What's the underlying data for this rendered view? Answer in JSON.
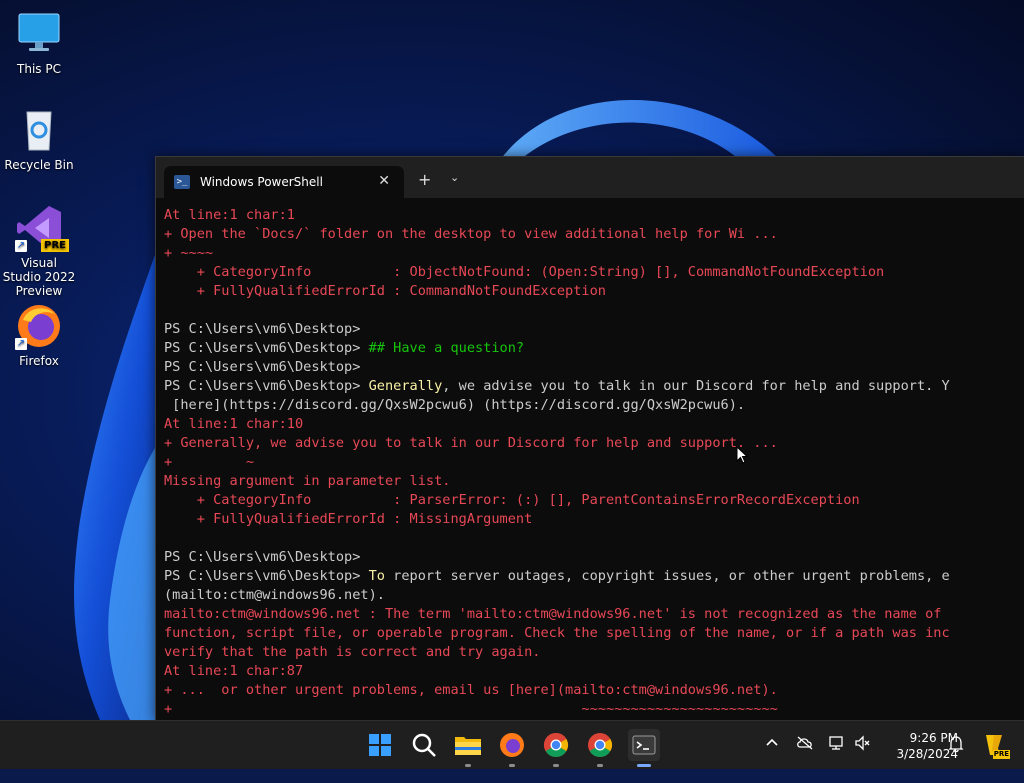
{
  "desktop": {
    "icons": [
      {
        "label": "This PC"
      },
      {
        "label": "Recycle Bin"
      },
      {
        "label": "Visual Studio 2022 Preview",
        "badge": "PRE"
      },
      {
        "label": "Firefox"
      }
    ]
  },
  "terminal": {
    "tab_title": "Windows PowerShell",
    "tab_icon_glyph": ">_",
    "close_glyph": "✕",
    "new_tab_glyph": "+",
    "dropdown_glyph": "⌄",
    "lines": [
      {
        "segments": [
          {
            "t": "err",
            "v": "At line:1 char:1"
          }
        ]
      },
      {
        "segments": [
          {
            "t": "err",
            "v": "+ Open the `Docs/` folder on the desktop to view additional help for Wi ..."
          }
        ]
      },
      {
        "segments": [
          {
            "t": "err",
            "v": "+ ~~~~"
          }
        ]
      },
      {
        "segments": [
          {
            "t": "err",
            "v": "    + CategoryInfo          : ObjectNotFound: (Open:String) [], CommandNotFoundException"
          }
        ]
      },
      {
        "segments": [
          {
            "t": "err",
            "v": "    + FullyQualifiedErrorId : CommandNotFoundException"
          }
        ]
      },
      {
        "segments": [
          {
            "t": "norm",
            "v": ""
          }
        ]
      },
      {
        "segments": [
          {
            "t": "norm",
            "v": "PS C:\\Users\\vm6\\Desktop>"
          }
        ]
      },
      {
        "segments": [
          {
            "t": "norm",
            "v": "PS C:\\Users\\vm6\\Desktop> "
          },
          {
            "t": "cmt",
            "v": "## Have a question?"
          }
        ]
      },
      {
        "segments": [
          {
            "t": "norm",
            "v": "PS C:\\Users\\vm6\\Desktop>"
          }
        ]
      },
      {
        "segments": [
          {
            "t": "norm",
            "v": "PS C:\\Users\\vm6\\Desktop> "
          },
          {
            "t": "cmd",
            "v": "Generally"
          },
          {
            "t": "norm",
            "v": ", we advise you to talk in our Discord for help and support. Y"
          }
        ]
      },
      {
        "segments": [
          {
            "t": "norm",
            "v": " [here](https://discord.gg/QxsW2pcwu6) (https://discord.gg/QxsW2pcwu6)."
          }
        ]
      },
      {
        "segments": [
          {
            "t": "err",
            "v": "At line:1 char:10"
          }
        ]
      },
      {
        "segments": [
          {
            "t": "err",
            "v": "+ Generally, we advise you to talk in our Discord for help and support. ..."
          }
        ]
      },
      {
        "segments": [
          {
            "t": "err",
            "v": "+         ~"
          }
        ]
      },
      {
        "segments": [
          {
            "t": "err",
            "v": "Missing argument in parameter list."
          }
        ]
      },
      {
        "segments": [
          {
            "t": "err",
            "v": "    + CategoryInfo          : ParserError: (:) [], ParentContainsErrorRecordException"
          }
        ]
      },
      {
        "segments": [
          {
            "t": "err",
            "v": "    + FullyQualifiedErrorId : MissingArgument"
          }
        ]
      },
      {
        "segments": [
          {
            "t": "norm",
            "v": ""
          }
        ]
      },
      {
        "segments": [
          {
            "t": "norm",
            "v": "PS C:\\Users\\vm6\\Desktop>"
          }
        ]
      },
      {
        "segments": [
          {
            "t": "norm",
            "v": "PS C:\\Users\\vm6\\Desktop> "
          },
          {
            "t": "cmd",
            "v": "To"
          },
          {
            "t": "norm",
            "v": " report server outages, copyright issues, or other urgent problems, e"
          }
        ]
      },
      {
        "segments": [
          {
            "t": "norm",
            "v": "(mailto:ctm@windows96.net)."
          }
        ]
      },
      {
        "segments": [
          {
            "t": "err",
            "v": "mailto:ctm@windows96.net : The term 'mailto:ctm@windows96.net' is not recognized as the name of"
          }
        ]
      },
      {
        "segments": [
          {
            "t": "err",
            "v": "function, script file, or operable program. Check the spelling of the name, or if a path was inc"
          }
        ]
      },
      {
        "segments": [
          {
            "t": "err",
            "v": "verify that the path is correct and try again."
          }
        ]
      },
      {
        "segments": [
          {
            "t": "err",
            "v": "At line:1 char:87"
          }
        ]
      },
      {
        "segments": [
          {
            "t": "err",
            "v": "+ ...  or other urgent problems, email us [here](mailto:ctm@windows96.net)."
          }
        ]
      },
      {
        "segments": [
          {
            "t": "err",
            "v": "+                                                  ~~~~~~~~~~~~~~~~~~~~~~~~"
          }
        ]
      }
    ]
  },
  "taskbar": {
    "items": [
      "start",
      "search",
      "file-explorer",
      "firefox",
      "chrome",
      "chrome",
      "terminal"
    ],
    "tray": {
      "time": "9:26 PM",
      "date": "3/28/2024",
      "badge": "PRE"
    }
  },
  "colors": {
    "error": "#e74856",
    "command": "#f9f1a5",
    "comment": "#16c60c",
    "text": "#cccccc",
    "accent": "#7aa7ff"
  }
}
